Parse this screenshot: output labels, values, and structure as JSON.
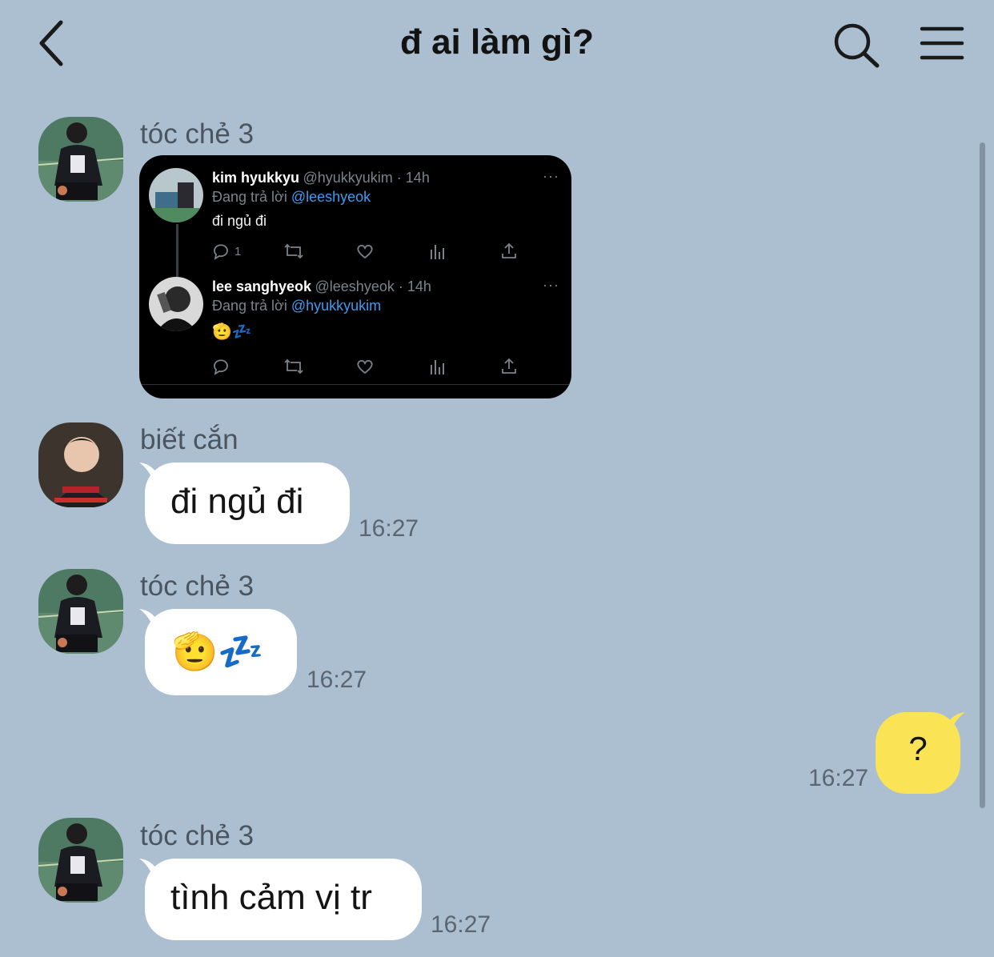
{
  "header": {
    "title": "đ ai làm gì?",
    "back_icon": "chevron-left-icon",
    "search_icon": "search-icon",
    "menu_icon": "hamburger-menu-icon"
  },
  "messages": [
    {
      "sender": "tóc chẻ 3",
      "type": "tweet-screenshot",
      "tweet": {
        "first": {
          "name": "kim hyukkyu",
          "handle": "@hyukkyukim · 14h",
          "reply_prefix": "Đang trả lời",
          "reply_to": "@leeshyeok",
          "text": "đi ngủ đi",
          "reply_count": "1",
          "more": "···"
        },
        "second": {
          "name": "lee sanghyeok",
          "handle": "@leeshyeok · 14h",
          "reply_prefix": "Đang trả lời",
          "reply_to": "@hyukkyukim",
          "text": "🫡💤",
          "more": "···"
        }
      }
    },
    {
      "sender": "biết cắn",
      "text": "đi ngủ đi",
      "time": "16:27"
    },
    {
      "sender": "tóc chẻ 3",
      "text": "🫡💤",
      "time": "16:27"
    },
    {
      "sender": "me",
      "text": "?",
      "time": "16:27"
    },
    {
      "sender": "tóc chẻ 3",
      "text": "tình cảm vị tr",
      "time": "16:27"
    }
  ],
  "colors": {
    "background": "#abbfd1",
    "incoming_bubble": "#ffffff",
    "outgoing_bubble": "#fae456",
    "tweet_mention": "#3d9bf0"
  }
}
